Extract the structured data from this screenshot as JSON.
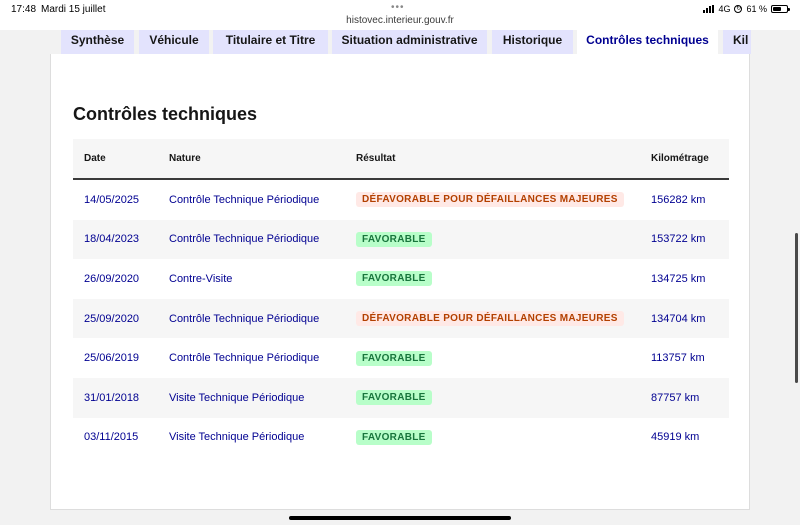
{
  "status_bar": {
    "time": "17:48",
    "date": "Mardi 15 juillet",
    "url": "histovec.interieur.gouv.fr",
    "network": "4G",
    "battery": "61 %",
    "battery_level": 0.61,
    "icons": [
      "more-dots-icon",
      "signal-icon",
      "orientation-lock-icon",
      "battery-icon"
    ]
  },
  "tabs": [
    {
      "label": "Synthèse",
      "active": false
    },
    {
      "label": "Véhicule",
      "active": false
    },
    {
      "label": "Titulaire et Titre",
      "active": false
    },
    {
      "label": "Situation administrative",
      "active": false
    },
    {
      "label": "Historique",
      "active": false
    },
    {
      "label": "Contrôles techniques",
      "active": true
    },
    {
      "label": "Kil",
      "active": false
    }
  ],
  "section": {
    "title": "Contrôles techniques"
  },
  "table": {
    "headers": {
      "date": "Date",
      "nature": "Nature",
      "result": "Résultat",
      "km": "Kilométrage"
    },
    "rows": [
      {
        "date": "14/05/2025",
        "nature": "Contrôle Technique Périodique",
        "result": "DÉFAVORABLE POUR DÉFAILLANCES MAJEURES",
        "status": "ko",
        "km": "156282 km"
      },
      {
        "date": "18/04/2023",
        "nature": "Contrôle Technique Périodique",
        "result": "FAVORABLE",
        "status": "ok",
        "km": "153722 km"
      },
      {
        "date": "26/09/2020",
        "nature": "Contre-Visite",
        "result": "FAVORABLE",
        "status": "ok",
        "km": "134725 km"
      },
      {
        "date": "25/09/2020",
        "nature": "Contrôle Technique Périodique",
        "result": "DÉFAVORABLE POUR DÉFAILLANCES MAJEURES",
        "status": "ko",
        "km": "134704 km"
      },
      {
        "date": "25/06/2019",
        "nature": "Contrôle Technique Périodique",
        "result": "FAVORABLE",
        "status": "ok",
        "km": "113757 km"
      },
      {
        "date": "31/01/2018",
        "nature": "Visite Technique Périodique",
        "result": "FAVORABLE",
        "status": "ok",
        "km": "87757 km"
      },
      {
        "date": "03/11/2015",
        "nature": "Visite Technique Périodique",
        "result": "FAVORABLE",
        "status": "ok",
        "km": "45919 km"
      }
    ]
  },
  "colors": {
    "accent": "#000091",
    "tab_inactive": "#e3e3fd",
    "badge_ok_bg": "#b8fec9",
    "badge_ok_text": "#18753c",
    "badge_ko_bg": "#ffe9e6",
    "badge_ko_text": "#b34000"
  }
}
